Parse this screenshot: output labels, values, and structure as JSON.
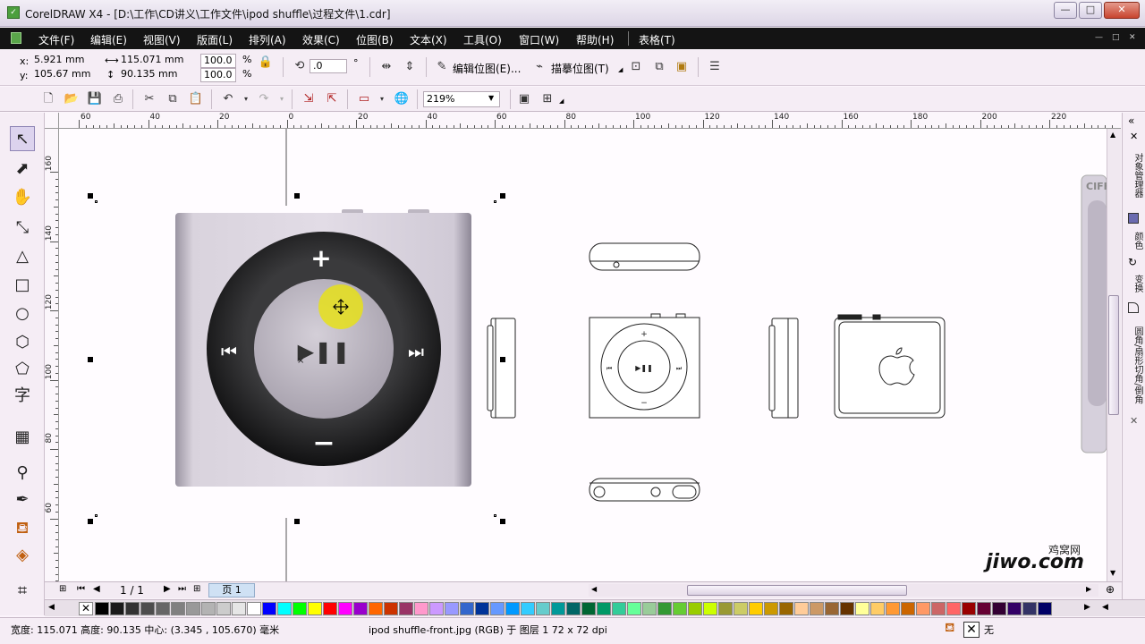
{
  "window": {
    "title": "CorelDRAW X4 - [D:\\工作\\CD讲义\\工作文件\\ipod shuffle\\过程文件\\1.cdr]",
    "minimize_glyph": "—",
    "maximize_glyph": "□",
    "close_glyph": "✕"
  },
  "menu": {
    "items": [
      "文件(F)",
      "编辑(E)",
      "视图(V)",
      "版面(L)",
      "排列(A)",
      "效果(C)",
      "位图(B)",
      "文本(X)",
      "工具(O)",
      "窗口(W)",
      "帮助(H)",
      "表格(T)"
    ],
    "doc_min": "—",
    "doc_restore": "□",
    "doc_close": "✕"
  },
  "property_bar": {
    "x_label": "x:",
    "x_value": "5.921 mm",
    "y_label": "y:",
    "y_value": "105.67 mm",
    "width_value": "115.071 mm",
    "height_value": "90.135 mm",
    "scale_x": "100.0",
    "scale_y": "100.0",
    "percent": "%",
    "rotation_value": ".0",
    "degree": "°",
    "edit_bitmap_label": "编辑位图(E)...",
    "trace_bitmap_label": "描摹位图(T)"
  },
  "standard_bar": {
    "zoom_value": "219%"
  },
  "rulers": {
    "h_labels": [
      "60",
      "40",
      "20",
      "0",
      "20",
      "40",
      "60",
      "80",
      "100",
      "120",
      "140",
      "160",
      "180",
      "200",
      "220"
    ],
    "v_labels": [
      "160",
      "140",
      "120",
      "100",
      "80",
      "60"
    ]
  },
  "canvas": {
    "ipod_plus": "+",
    "ipod_minus": "−",
    "ipod_prev": "⏮",
    "ipod_next": "⏭",
    "ipod_playpause": "▶❚❚",
    "partial_text": "CIFF"
  },
  "page_nav": {
    "counter": "1 / 1",
    "page_tab": "页 1"
  },
  "palette": {
    "colors": [
      "#000000",
      "#1a1a1a",
      "#333333",
      "#4d4d4d",
      "#666666",
      "#808080",
      "#999999",
      "#b3b3b3",
      "#cccccc",
      "#e6e6e6",
      "#ffffff",
      "#0000ff",
      "#00ffff",
      "#00ff00",
      "#ffff00",
      "#ff0000",
      "#ff00ff",
      "#9900cc",
      "#ff6600",
      "#cc3300",
      "#993366",
      "#ff99cc",
      "#cc99ff",
      "#9999ff",
      "#3366cc",
      "#003399",
      "#6699ff",
      "#0099ff",
      "#33ccff",
      "#66cccc",
      "#009999",
      "#006666",
      "#006633",
      "#009966",
      "#33cc99",
      "#66ff99",
      "#99cc99",
      "#339933",
      "#66cc33",
      "#99cc00",
      "#ccff00",
      "#999933",
      "#cccc66",
      "#ffcc00",
      "#cc9900",
      "#996600",
      "#ffcc99",
      "#cc9966",
      "#996633",
      "#663300",
      "#ffff99",
      "#ffcc66",
      "#ff9933",
      "#cc6600",
      "#ff9966",
      "#cc6666",
      "#ff6666",
      "#990000",
      "#660033",
      "#330033",
      "#330066",
      "#333366",
      "#000066"
    ]
  },
  "status_bar": {
    "dims_text": "宽度: 115.071  高度: 90.135  中心: (3.345 , 105.670)  毫米",
    "object_text": "ipod shuffle-front.jpg (RGB) 于 图层 1 72 x 72 dpi",
    "fill_none": "无"
  },
  "dockers": {
    "tab1": "对象管理器",
    "tab2": "颜色",
    "tab3": "变换",
    "tab4": "圆角/扇形切角/倒角"
  },
  "watermark": {
    "cn": "鸡窝网",
    "en": "jiwo.com"
  }
}
